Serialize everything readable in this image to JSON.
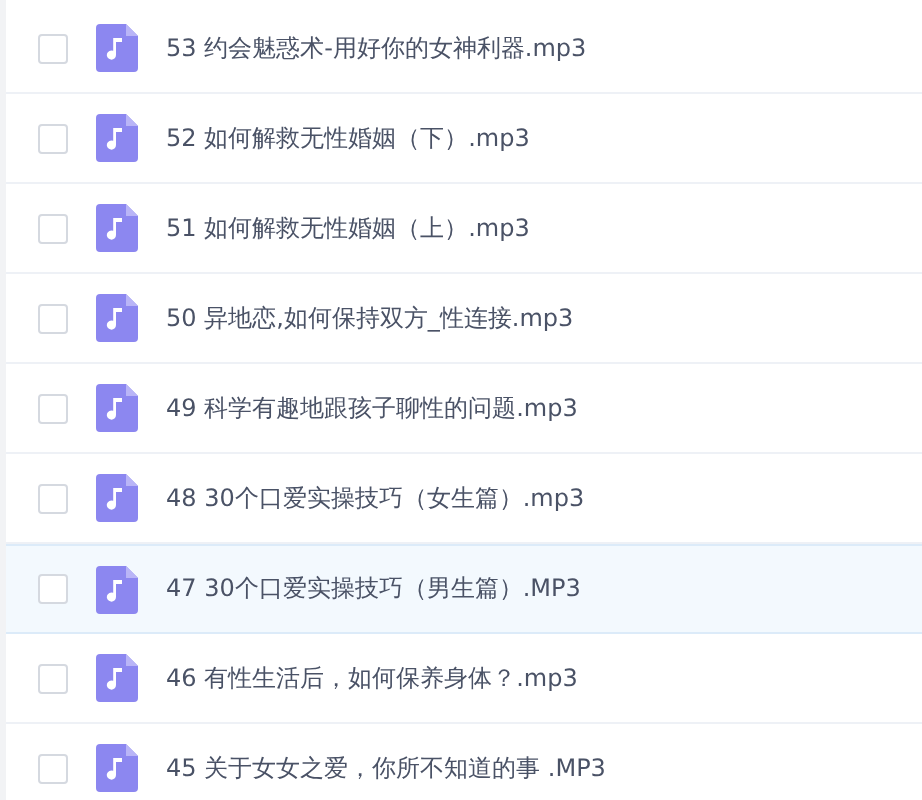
{
  "files": [
    {
      "name": "53 约会魅惑术-用好你的女神利器.mp3",
      "checked": false,
      "highlighted": false
    },
    {
      "name": "52 如何解救无性婚姻（下）.mp3",
      "checked": false,
      "highlighted": false
    },
    {
      "name": "51 如何解救无性婚姻（上）.mp3",
      "checked": false,
      "highlighted": false
    },
    {
      "name": "50 异地恋,如何保持双方_性连接.mp3",
      "checked": false,
      "highlighted": false
    },
    {
      "name": "49 科学有趣地跟孩子聊性的问题.mp3",
      "checked": false,
      "highlighted": false
    },
    {
      "name": "48 30个口爱实操技巧（女生篇）.mp3",
      "checked": false,
      "highlighted": false
    },
    {
      "name": "47 30个口爱实操技巧（男生篇）.MP3",
      "checked": false,
      "highlighted": true
    },
    {
      "name": "46 有性生活后，如何保养身体？.mp3",
      "checked": false,
      "highlighted": false
    },
    {
      "name": "45 关于女女之爱，你所不知道的事 .MP3",
      "checked": false,
      "highlighted": false
    }
  ]
}
